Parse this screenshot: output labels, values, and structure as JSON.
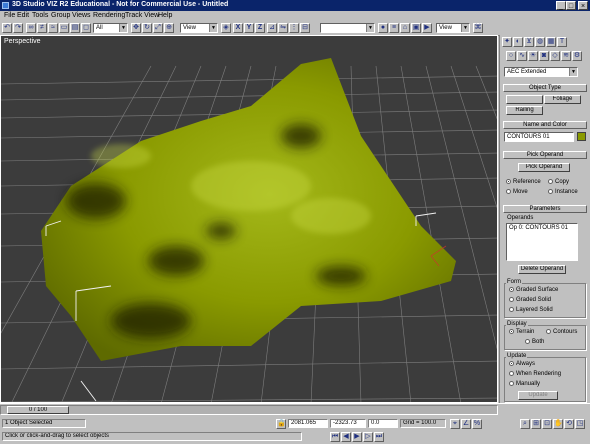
{
  "window": {
    "title": "3D Studio VIZ R2 Educational - Not for Commercial Use - Untitled"
  },
  "menu": [
    "File",
    "Edit",
    "Tools",
    "Group",
    "Views",
    "Rendering",
    "Track View",
    "Help"
  ],
  "toolbar": {
    "selection_filter": "All",
    "ref_coord": "View",
    "axis_x": "X",
    "axis_y": "Y",
    "axis_z": "Z",
    "named_selection": "",
    "view_dropdown": "View"
  },
  "viewport": {
    "label": "Perspective"
  },
  "command_panel": {
    "category_dropdown": "AEC Extended",
    "object_type": {
      "title": "Object Type",
      "buttons": [
        "",
        "Foliage",
        "Railing"
      ]
    },
    "name_color": {
      "title": "Name and Color",
      "name": "CONTOURS 01",
      "color": "#8a9a00"
    },
    "pick_operand": {
      "title": "Pick Operand",
      "button": "Pick Operand",
      "options": [
        "Reference",
        "Copy",
        "Move",
        "Instance"
      ],
      "selected": "Reference"
    },
    "parameters": {
      "title": "Parameters",
      "operands_label": "Operands",
      "operands": [
        "Op 0: CONTOURS 01"
      ],
      "delete_button": "Delete Operand",
      "form_label": "Form",
      "form_options": [
        "Graded Surface",
        "Graded Solid",
        "Layered Solid"
      ],
      "form_selected": "Graded Surface",
      "display_label": "Display",
      "display_options": [
        "Terrain",
        "Contours",
        "Both"
      ],
      "display_selected": "Terrain",
      "update_label": "Update",
      "update_options": [
        "Always",
        "When Rendering",
        "Manually"
      ],
      "update_selected": "Always",
      "update_button": "Update"
    }
  },
  "timeline": {
    "frame": "0 / 100"
  },
  "status": {
    "selection": "1 Object Selected",
    "prompt": "Click or click-and-drag to select objects",
    "x": "2081.065",
    "y": "-2323.73",
    "z": "0.0",
    "grid": "Grid = 100.0"
  },
  "colors": {
    "terrain": "#8a9a00",
    "titlebar": "#0a246a",
    "viewport_bg": "#3c3c3c"
  }
}
